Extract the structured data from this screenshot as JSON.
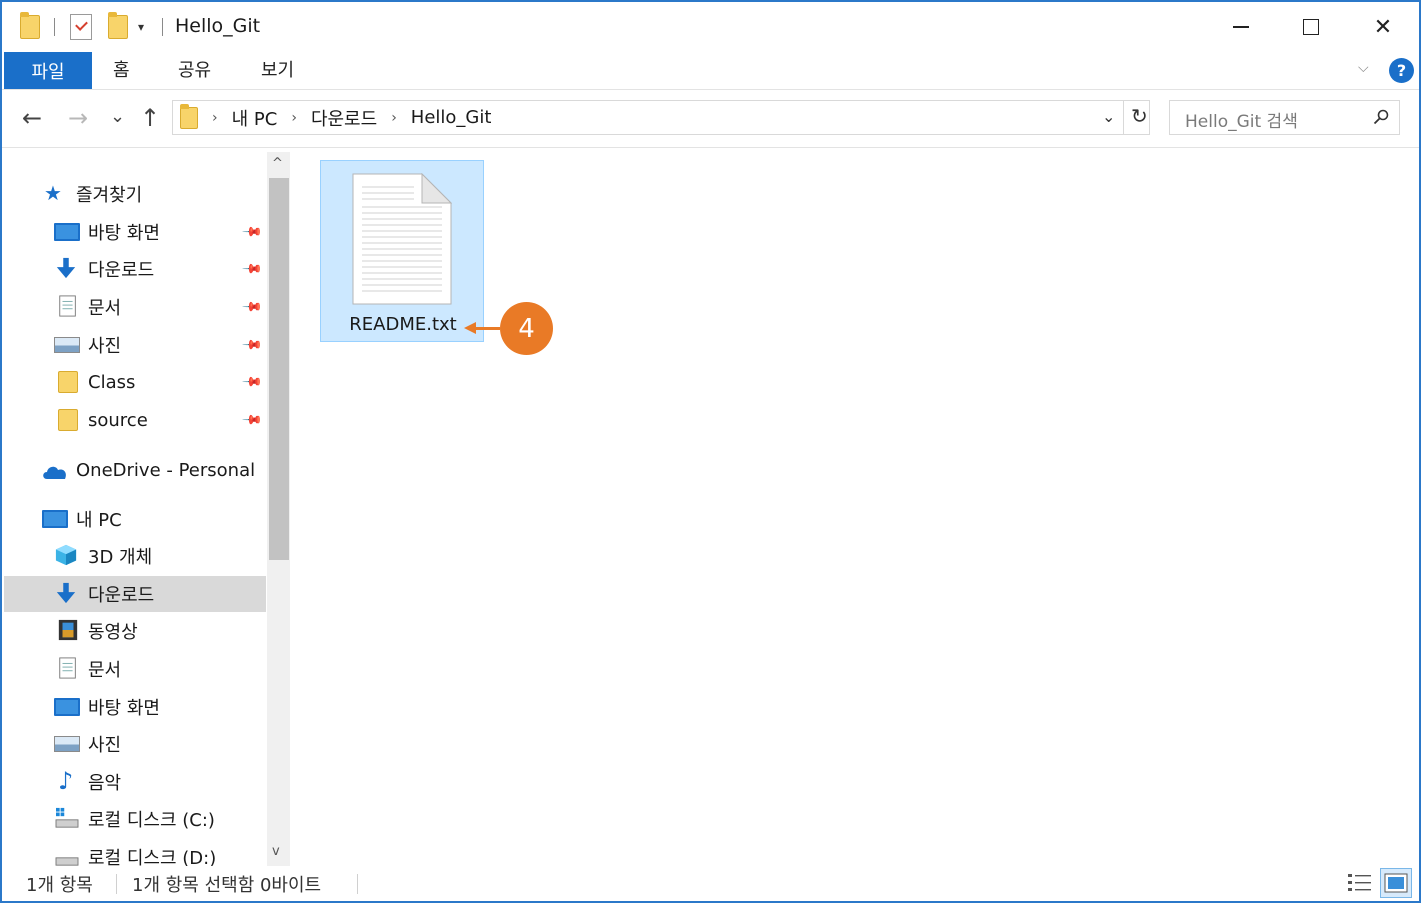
{
  "window": {
    "title": "Hello_Git",
    "qa_dropdown": "▾",
    "close_glyph": "✕"
  },
  "ribbon": {
    "tabs": [
      "파일",
      "홈",
      "공유",
      "보기"
    ],
    "help": "?",
    "collapse_glyph": "⌵"
  },
  "nav": {
    "back": "←",
    "forward": "→",
    "recent": "⌄",
    "up": "↑",
    "breadcrumbs": [
      "내 PC",
      "다운로드",
      "Hello_Git"
    ],
    "crumb_sep": "›",
    "addr_dropdown": "⌄",
    "refresh": "↻",
    "search_placeholder": "Hello_Git 검색"
  },
  "sidebar": {
    "quick_access": {
      "label": "즐겨찾기",
      "items": [
        {
          "label": "바탕 화면",
          "icon": "desktop-icon"
        },
        {
          "label": "다운로드",
          "icon": "download-icon"
        },
        {
          "label": "문서",
          "icon": "documents-icon"
        },
        {
          "label": "사진",
          "icon": "pictures-icon"
        },
        {
          "label": "Class",
          "icon": "folder-icon"
        },
        {
          "label": "source",
          "icon": "folder-icon"
        }
      ]
    },
    "onedrive": {
      "label": "OneDrive - Personal",
      "icon": "onedrive-icon"
    },
    "this_pc": {
      "label": "내 PC",
      "items": [
        {
          "label": "3D 개체",
          "icon": "3d-objects-icon"
        },
        {
          "label": "다운로드",
          "icon": "download-icon",
          "selected": true
        },
        {
          "label": "동영상",
          "icon": "videos-icon"
        },
        {
          "label": "문서",
          "icon": "documents-icon"
        },
        {
          "label": "바탕 화면",
          "icon": "desktop-icon"
        },
        {
          "label": "사진",
          "icon": "pictures-icon"
        },
        {
          "label": "음악",
          "icon": "music-icon"
        },
        {
          "label": "로컬 디스크 (C:)",
          "icon": "drive-c-icon"
        },
        {
          "label": "로컬 디스크 (D:)",
          "icon": "drive-d-icon"
        }
      ]
    },
    "scroll_up": "^",
    "scroll_down": "v"
  },
  "content": {
    "files": [
      {
        "name": "README.txt",
        "icon": "text-file-icon",
        "selected": true
      }
    ],
    "callout": {
      "number": "4",
      "color": "#e97a26"
    }
  },
  "status": {
    "item_count": "1개 항목",
    "selection": "1개 항목 선택함 0바이트"
  },
  "colors": {
    "accent": "#1a6fc9",
    "selection": "#cce8ff",
    "callout": "#e97a26"
  }
}
